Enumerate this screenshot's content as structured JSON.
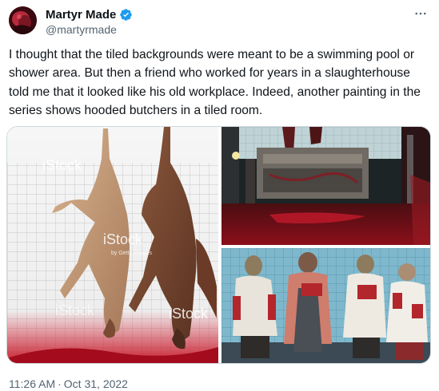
{
  "author": {
    "display_name": "Martyr Made",
    "handle": "@martyrmade",
    "verified": true
  },
  "tweet": {
    "text": "I thought that the tiled backgrounds were meant to be a swimming pool or shower area. But then a friend who worked for years in a slaughterhouse told me that it looked like his old workplace. Indeed, another painting in the series shows hooded butchers in a tiled room."
  },
  "media": {
    "watermark": "iStock",
    "watermark_sub": "by Getty Images",
    "images": [
      {
        "name": "carcasses-photo"
      },
      {
        "name": "slaughterhouse-room-photo"
      },
      {
        "name": "hooded-butchers-painting"
      }
    ]
  },
  "meta": {
    "time": "11:26 AM",
    "separator": "·",
    "date": "Oct 31, 2022"
  },
  "colors": {
    "text_primary": "#0f1419",
    "text_secondary": "#536471",
    "verified_blue": "#1d9bf0",
    "border": "#cfd9de"
  },
  "icons": {
    "verified": "verified-badge-icon",
    "more": "more-horizontal-icon"
  }
}
